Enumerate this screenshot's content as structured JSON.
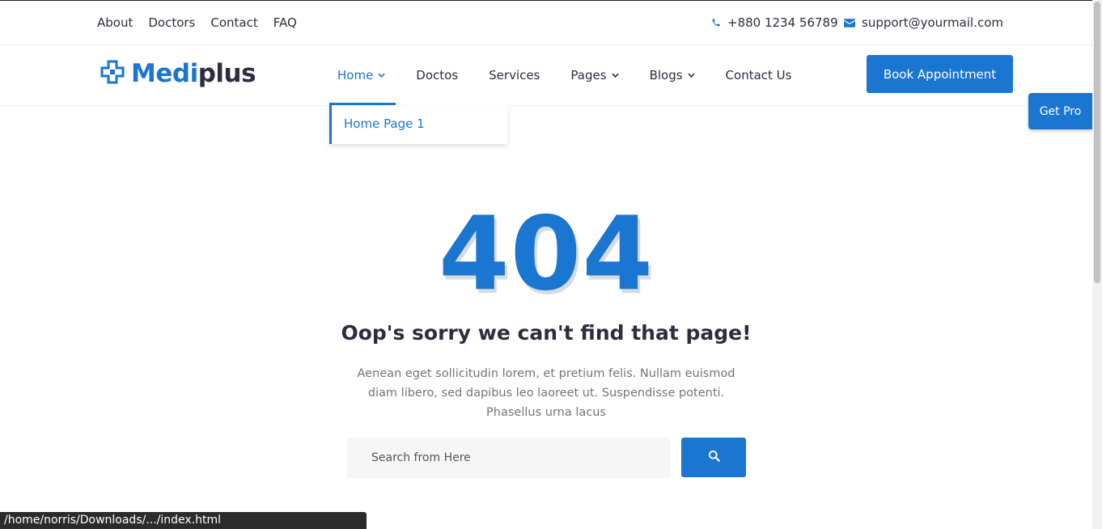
{
  "topbar": {
    "links": [
      "About",
      "Doctors",
      "Contact",
      "FAQ"
    ],
    "phone": "+880 1234 56789",
    "email": "support@yourmail.com"
  },
  "logo": {
    "part1": "Medi",
    "part2": "plus",
    "icon": "medical-cross-icon"
  },
  "nav": {
    "items": [
      "Home",
      "Doctos",
      "Services",
      "Pages",
      "Blogs",
      "Contact Us"
    ],
    "active": "Home"
  },
  "dropdown": {
    "items": [
      "Home Page 1"
    ]
  },
  "book_button": "Book Appointment",
  "get_pro": "Get Pro",
  "error": {
    "code": "404",
    "title": "Oop's sorry we can't find that page!",
    "text": "Aenean eget sollicitudin lorem, et pretium felis. Nullam euismod diam libero, sed dapibus leo laoreet ut. Suspendisse potenti. Phasellus urna lacus"
  },
  "search": {
    "placeholder": "Search from Here",
    "value": ""
  },
  "status_bar": "/home/norris/Downloads/.../index.html",
  "colors": {
    "primary": "#1a76d1",
    "text": "#2c2d3f",
    "muted": "#757575"
  }
}
